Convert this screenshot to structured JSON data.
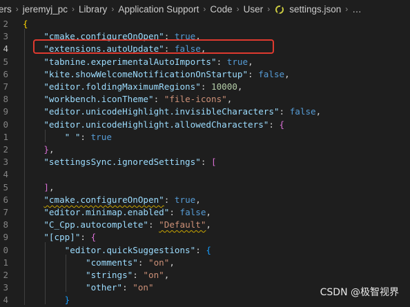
{
  "breadcrumb": [
    "ers",
    "jeremyj_pc",
    "Library",
    "Application Support",
    "Code",
    "User",
    "settings.json",
    "…"
  ],
  "breadcrumb_sep": "›",
  "line_numbers": [
    "2",
    "3",
    "4",
    "5",
    "6",
    "7",
    "8",
    "9",
    "0",
    "1",
    "2",
    "3",
    "4",
    "5",
    "6",
    "7",
    "8",
    "9",
    "0",
    "1",
    "2",
    "3",
    "4"
  ],
  "active_line_index": 2,
  "code": {
    "open_brace": "{",
    "l1_key": "\"cmake.configureOnOpen\"",
    "l1_val": "true",
    "l2_key": "\"extensions.autoUpdate\"",
    "l2_val": "false",
    "l3_key": "\"tabnine.experimentalAutoImports\"",
    "l3_val": "true",
    "l4_key": "\"kite.showWelcomeNotificationOnStartup\"",
    "l4_val": "false",
    "l5_key": "\"editor.foldingMaximumRegions\"",
    "l5_val": "10000",
    "l6_key": "\"workbench.iconTheme\"",
    "l6_val": "\"file-icons\"",
    "l7_key": "\"editor.unicodeHighlight.invisibleCharacters\"",
    "l7_val": "false",
    "l8_key": "\"editor.unicodeHighlight.allowedCharacters\"",
    "l8_brace": "{",
    "l9_key": "\" \"",
    "l9_val": "true",
    "l10_close": "}",
    "l11_key": "\"settingsSync.ignoredSettings\"",
    "l11_bracket": "[",
    "l13_close": "]",
    "l14_key": "\"cmake.configureOnOpen\"",
    "l14_val": "true",
    "l15_key": "\"editor.minimap.enabled\"",
    "l15_val": "false",
    "l16_key": "\"C_Cpp.autocomplete\"",
    "l16_val": "\"Default\"",
    "l17_key": "\"[cpp]\"",
    "l17_brace": "{",
    "l18_key": "\"editor.quickSuggestions\"",
    "l18_brace": "{",
    "l19_key": "\"comments\"",
    "l19_val": "\"on\"",
    "l20_key": "\"strings\"",
    "l20_val": "\"on\"",
    "l21_key": "\"other\"",
    "l21_val": "\"on\"",
    "l22_close": "}"
  },
  "watermark": "CSDN @极智视界",
  "colors": {
    "background": "#1e1e1e",
    "key": "#9cdcfe",
    "string": "#ce9178",
    "boolean": "#569cd6",
    "number": "#b5cea8",
    "highlight_box": "#e03a2f"
  }
}
